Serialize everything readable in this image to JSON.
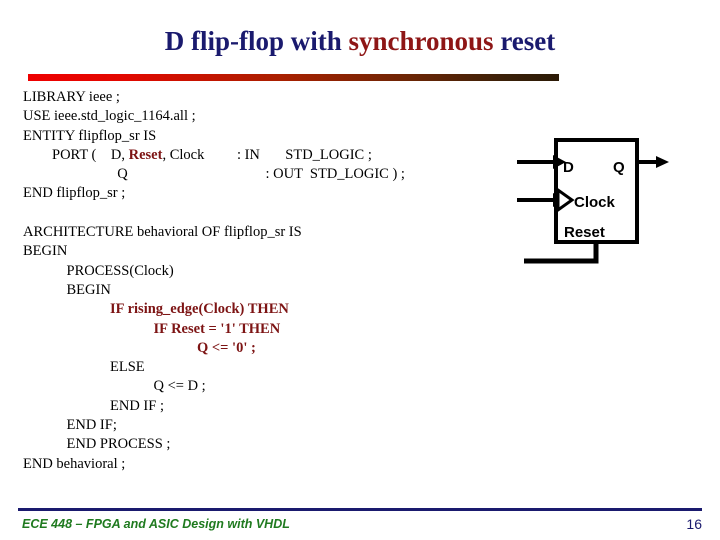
{
  "slide": {
    "title_part_1": "D flip-flop with ",
    "title_part_2": "synchronous",
    "title_part_3": " reset",
    "title_full": "D flip-flop with synchronous reset",
    "accent_red": "#8e1616",
    "accent_navy": "#1a1a6e",
    "rule_gradient_start": "#ee0000",
    "rule_gradient_end": "#2b1a06"
  },
  "code": {
    "line_01": "LIBRARY ieee ;",
    "line_02": "USE ieee.std_logic_1164.all ;",
    "line_03": "ENTITY flipflop_sr IS",
    "line_04_a": "        PORT (    D, ",
    "line_04_reset": "Reset",
    "line_04_b": ", Clock         : IN       STD_LOGIC ;",
    "line_05": "                          Q                                      : OUT  STD_LOGIC ) ;",
    "line_06": "END flipflop_sr ;",
    "line_07": "",
    "line_08": "ARCHITECTURE behavioral OF flipflop_sr IS",
    "line_09": "BEGIN",
    "line_10": "            PROCESS(Clock)",
    "line_11": "            BEGIN",
    "line_12": "                        IF rising_edge(Clock) THEN",
    "line_13": "                                    IF Reset = '1' THEN",
    "line_14": "                                                Q <= '0' ;",
    "line_15": "                        ELSE",
    "line_16": "                                    Q <= D ;",
    "line_17": "                        END IF ;",
    "line_18": "            END IF;",
    "line_19": "            END PROCESS ;",
    "line_20": "END behavioral ;"
  },
  "diagram": {
    "name": "d-flip-flop-symbol",
    "port_d": "D",
    "port_q": "Q",
    "port_clock": "Clock",
    "port_reset": "Reset"
  },
  "footer": {
    "course_text": "ECE 448 – FPGA and ASIC Design with VHDL",
    "page_number": "16",
    "text_color": "#1f7a1f",
    "rule_color": "#1a1a6e"
  }
}
